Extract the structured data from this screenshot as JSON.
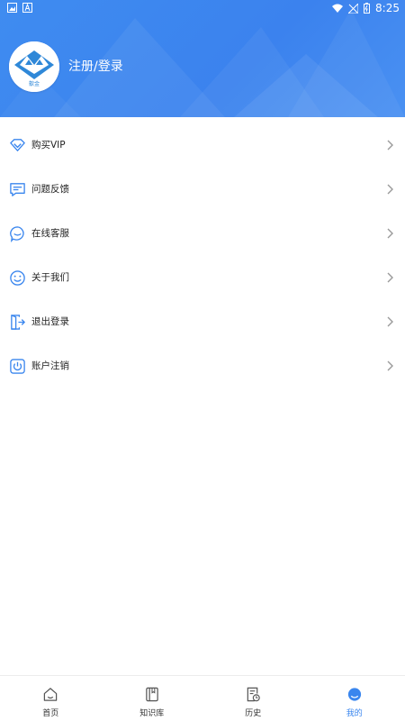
{
  "status_bar": {
    "time": "8:25"
  },
  "profile": {
    "login_label": "注册/登录",
    "avatar_caption": "歙金"
  },
  "menu": [
    {
      "label": "购买VIP",
      "icon": "diamond-icon"
    },
    {
      "label": "问题反馈",
      "icon": "feedback-icon"
    },
    {
      "label": "在线客服",
      "icon": "chat-icon"
    },
    {
      "label": "关于我们",
      "icon": "smile-icon"
    },
    {
      "label": "退出登录",
      "icon": "logout-icon"
    },
    {
      "label": "账户注销",
      "icon": "power-icon"
    }
  ],
  "tabs": [
    {
      "label": "首页",
      "icon": "home-icon",
      "active": false
    },
    {
      "label": "知识库",
      "icon": "book-icon",
      "active": false
    },
    {
      "label": "历史",
      "icon": "history-icon",
      "active": false
    },
    {
      "label": "我的",
      "icon": "profile-icon",
      "active": true
    }
  ],
  "colors": {
    "accent": "#3a86ee",
    "header": "#3f8cf0",
    "text": "#222222"
  }
}
